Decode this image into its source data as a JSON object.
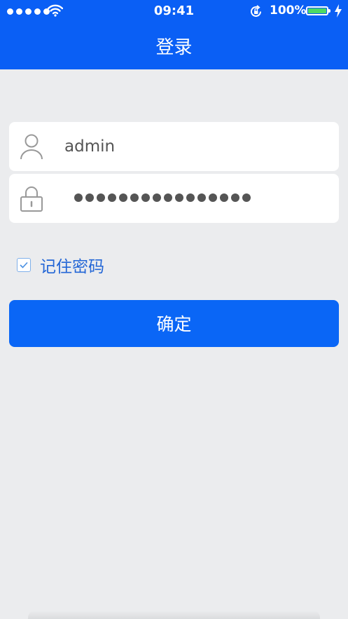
{
  "status_bar": {
    "time": "09:41",
    "battery_percent": "100%",
    "battery_level": 1.0,
    "signal_bars": 5
  },
  "header": {
    "title": "登录"
  },
  "login_form": {
    "username": "admin",
    "password_mask_count": 16,
    "remember_label": "记住密码",
    "remember_checked": true,
    "submit_label": "确定"
  },
  "colors": {
    "primary": "#0a66f6",
    "header_bg": "#0a5ff5",
    "background": "#ebecee",
    "battery_fill": "#4cd964"
  },
  "icons": {
    "user_field": "user-icon",
    "password_field": "lock-icon",
    "wifi": "wifi-icon",
    "rotation_lock": "rotation-lock-icon",
    "charging": "bolt-icon"
  }
}
